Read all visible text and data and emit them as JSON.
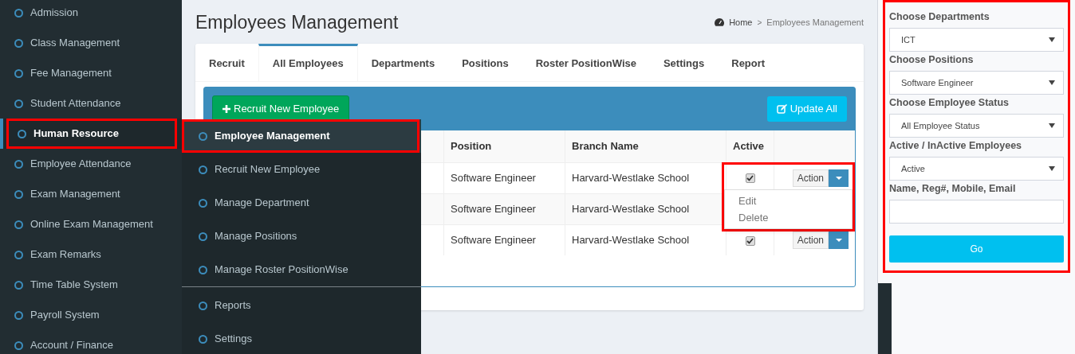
{
  "sidebar": {
    "items": [
      {
        "label": "Admission",
        "selected": false,
        "highlighted": false
      },
      {
        "label": "Class Management",
        "selected": false,
        "highlighted": false
      },
      {
        "label": "Fee Management",
        "selected": false,
        "highlighted": false
      },
      {
        "label": "Student Attendance",
        "selected": false,
        "highlighted": false
      },
      {
        "label": "Human Resource",
        "selected": true,
        "highlighted": true
      },
      {
        "label": "Employee Attendance",
        "selected": false,
        "highlighted": false
      },
      {
        "label": "Exam Management",
        "selected": false,
        "highlighted": false
      },
      {
        "label": "Online Exam Management",
        "selected": false,
        "highlighted": false
      },
      {
        "label": "Exam Remarks",
        "selected": false,
        "highlighted": false
      },
      {
        "label": "Time Table System",
        "selected": false,
        "highlighted": false
      },
      {
        "label": "Payroll System",
        "selected": false,
        "highlighted": false
      },
      {
        "label": "Account / Finance",
        "selected": false,
        "highlighted": false
      }
    ]
  },
  "submenu": {
    "groups": [
      [
        {
          "label": "Employee Management",
          "selected": true,
          "highlighted": true
        },
        {
          "label": "Recruit New Employee",
          "selected": false,
          "highlighted": false
        },
        {
          "label": "Manage Department",
          "selected": false,
          "highlighted": false
        },
        {
          "label": "Manage Positions",
          "selected": false,
          "highlighted": false
        },
        {
          "label": "Manage Roster PositionWise",
          "selected": false,
          "highlighted": false
        }
      ],
      [
        {
          "label": "Reports",
          "selected": false,
          "highlighted": false
        },
        {
          "label": "Settings",
          "selected": false,
          "highlighted": false
        }
      ]
    ]
  },
  "page": {
    "title": "Employees Management",
    "breadcrumb": {
      "home": "Home",
      "separator": ">",
      "current": "Employees Management"
    }
  },
  "tabs": [
    {
      "label": "Recruit",
      "selected": false
    },
    {
      "label": "All Employees",
      "selected": true
    },
    {
      "label": "Departments",
      "selected": false
    },
    {
      "label": "Positions",
      "selected": false
    },
    {
      "label": "Roster PositionWise",
      "selected": false
    },
    {
      "label": "Settings",
      "selected": false
    },
    {
      "label": "Report",
      "selected": false
    }
  ],
  "toolbar": {
    "recruit_button": "Recruit New Employee",
    "update_button": "Update All"
  },
  "table": {
    "columns": [
      "",
      "Position",
      "Branch Name",
      "Active",
      ""
    ],
    "rows": [
      {
        "position": "Software Engineer",
        "branch": "Harvard-Westlake School",
        "active": true,
        "action": "Action"
      },
      {
        "position": "Software Engineer",
        "branch": "Harvard-Westlake School"
      },
      {
        "position": "Software Engineer",
        "branch": "Harvard-Westlake School",
        "active": true,
        "action": "Action"
      }
    ]
  },
  "action_menu": {
    "highlighted": true,
    "items": [
      "Edit",
      "Delete"
    ]
  },
  "filters": {
    "highlighted": true,
    "fields": [
      {
        "kind": "select",
        "label": "Choose Departments",
        "value": "ICT"
      },
      {
        "kind": "select",
        "label": "Choose Positions",
        "value": "Software Engineer"
      },
      {
        "kind": "select",
        "label": "Choose Employee Status",
        "value": "All Employee Status"
      },
      {
        "kind": "select",
        "label": "Active / InActive Employees",
        "value": "Active"
      },
      {
        "kind": "text",
        "label": "Name, Reg#, Mobile, Email"
      }
    ],
    "button": "Go"
  }
}
